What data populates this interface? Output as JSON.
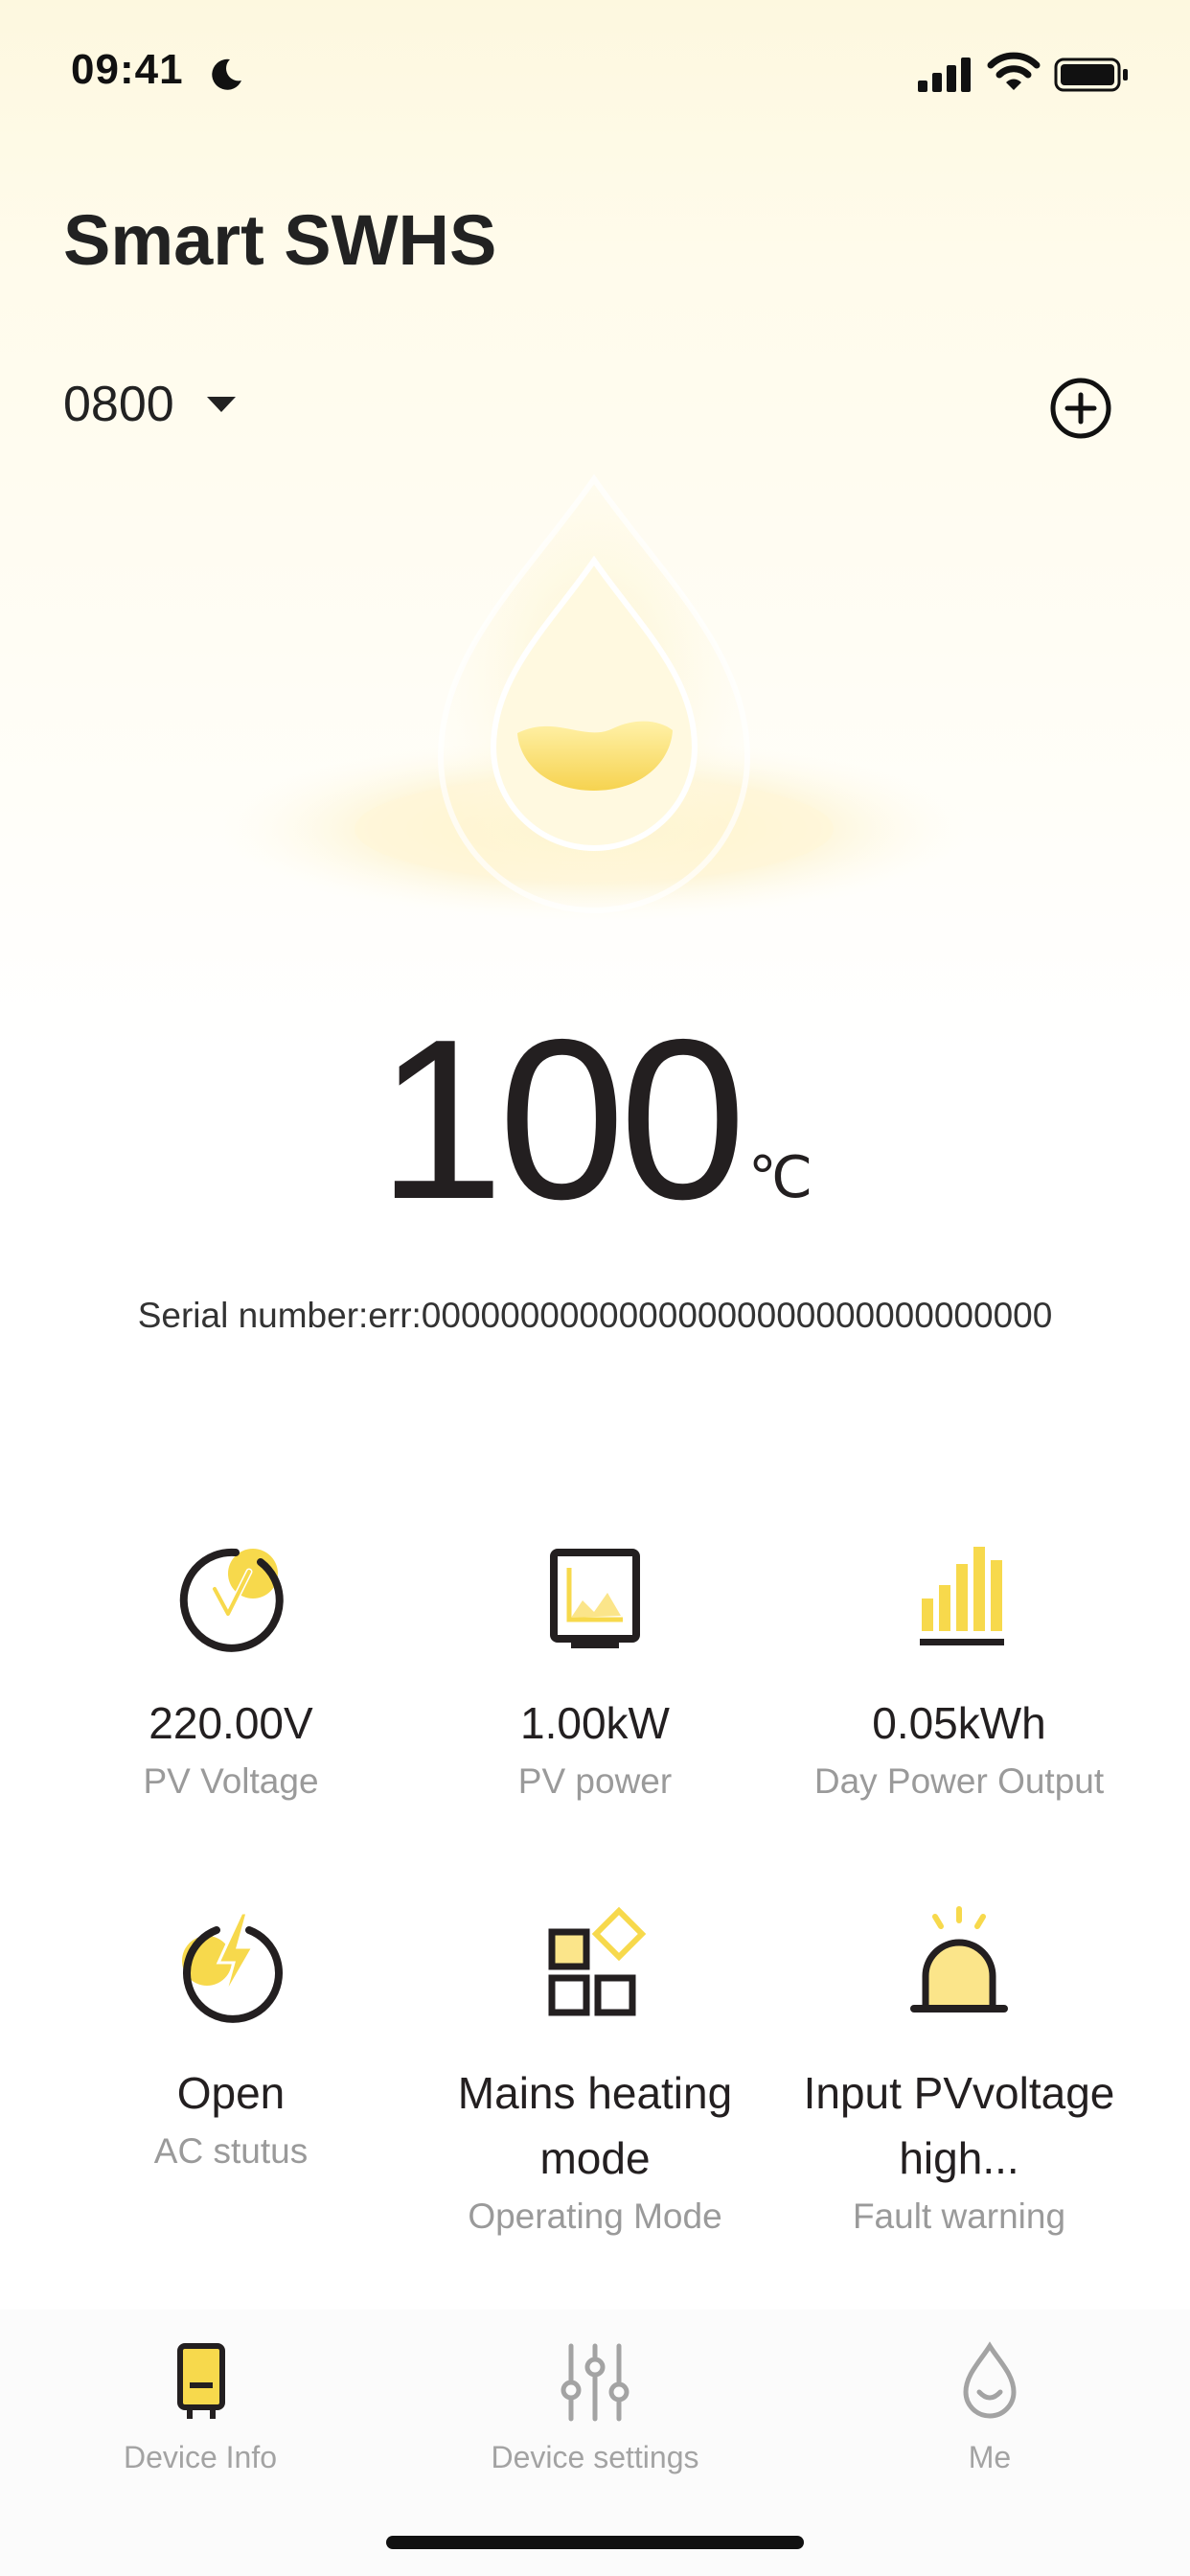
{
  "status_bar": {
    "time": "09:41"
  },
  "header": {
    "title": "Smart SWHS"
  },
  "device": {
    "selected": "0800"
  },
  "temperature": {
    "value": "100",
    "unit": "℃"
  },
  "serial": {
    "text": "Serial number:err:00000000000000000000000000000000"
  },
  "metrics": [
    {
      "value": "220.00V",
      "label": "PV Voltage",
      "icon": "voltage-icon"
    },
    {
      "value": "1.00kW",
      "label": "PV power",
      "icon": "power-monitor-icon"
    },
    {
      "value": "0.05kWh",
      "label": "Day Power Output",
      "icon": "bar-chart-icon"
    },
    {
      "value": "Open",
      "label": "AC stutus",
      "icon": "lightning-power-icon"
    },
    {
      "value_line1": "Mains heating",
      "value_line2": "mode",
      "label": "Operating Mode",
      "icon": "mode-grid-icon"
    },
    {
      "value_line1": "Input PVvoltage",
      "value_line2": "high...",
      "label": "Fault warning",
      "icon": "alarm-light-icon"
    }
  ],
  "tabs": [
    {
      "label": "Device Info",
      "icon": "device-icon"
    },
    {
      "label": "Device settings",
      "icon": "sliders-icon"
    },
    {
      "label": "Me",
      "icon": "drop-face-icon"
    }
  ],
  "colors": {
    "accent": "#f7d94c",
    "text": "#231f20",
    "muted": "#9a9a9a"
  }
}
